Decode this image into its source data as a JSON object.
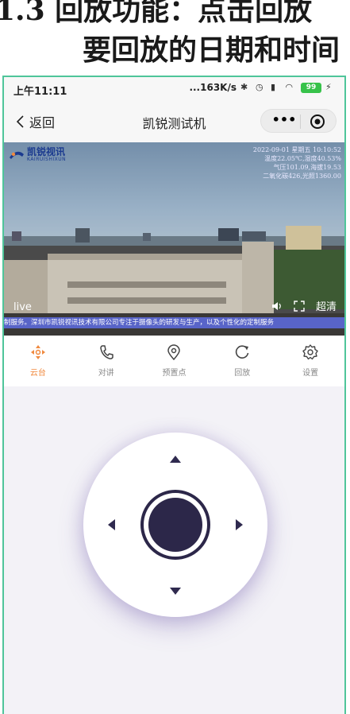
{
  "doc_heading": {
    "line1": "1.3 回放功能：点击回放",
    "line2": "要回放的日期和时间"
  },
  "status_bar": {
    "time": "上午11:11",
    "net_speed": "...163K/s",
    "battery": "99"
  },
  "nav": {
    "back_label": "返回",
    "title": "凯锐测试机",
    "more_label": "•••"
  },
  "video": {
    "brand_cn": "凯锐视讯",
    "brand_en": "KAIRUISHIXUN",
    "osd_lines": [
      "2022-09-01 星期五 10:10:52",
      "温度22.05℃,湿度40.53%",
      "气压101.09,海拔19.53",
      "二氧化碳426,光照1360.00"
    ],
    "live_label": "live",
    "quality_label": "超清",
    "ticker": "制服务。深圳市凯锐视讯技术有限公司专注于摄像头的研发与生产，以及个性化的定制服务"
  },
  "tabs": [
    {
      "label": "云台",
      "icon": "ptz-icon",
      "active": true
    },
    {
      "label": "对讲",
      "icon": "phone-icon",
      "active": false
    },
    {
      "label": "预置点",
      "icon": "location-pin-icon",
      "active": false
    },
    {
      "label": "回放",
      "icon": "replay-icon",
      "active": false
    },
    {
      "label": "设置",
      "icon": "gear-icon",
      "active": false
    }
  ],
  "colors": {
    "accent": "#f0893e",
    "phone_border": "#4fc59a",
    "ticker_bg": "#5864c8",
    "dpad_dark": "#2c2749"
  }
}
